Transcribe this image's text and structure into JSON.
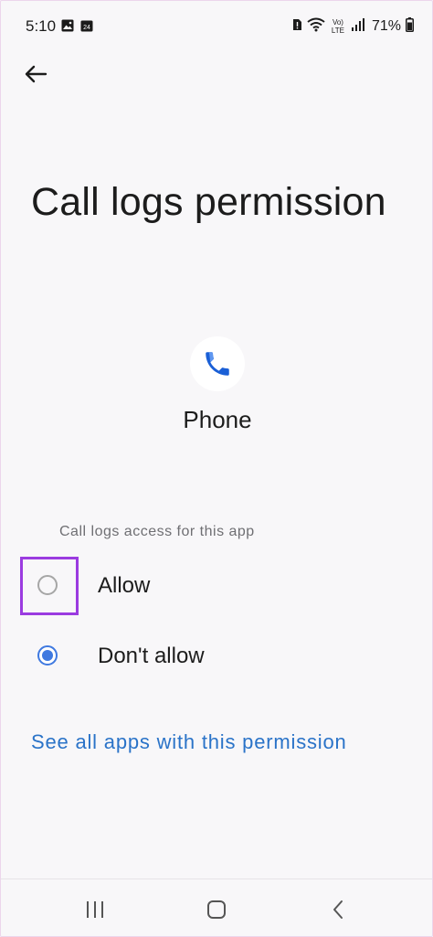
{
  "status_bar": {
    "time": "5:10",
    "date_badge": "24",
    "network_label": "Vo) LTE",
    "battery": "71%"
  },
  "icons": {
    "back": "arrow-left-icon",
    "app": "phone-icon",
    "recent": "recent-apps-icon",
    "home": "home-icon",
    "nav_back": "chevron-left-icon"
  },
  "page": {
    "title": "Call logs permission",
    "app_name": "Phone",
    "section_label": "Call logs access for this app"
  },
  "options": [
    {
      "label": "Allow",
      "selected": false
    },
    {
      "label": "Don't allow",
      "selected": true
    }
  ],
  "link": {
    "label": "See all apps with this permission"
  },
  "colors": {
    "accent": "#3f79e0",
    "link": "#2a73c8",
    "highlight": "#9b3be0"
  }
}
